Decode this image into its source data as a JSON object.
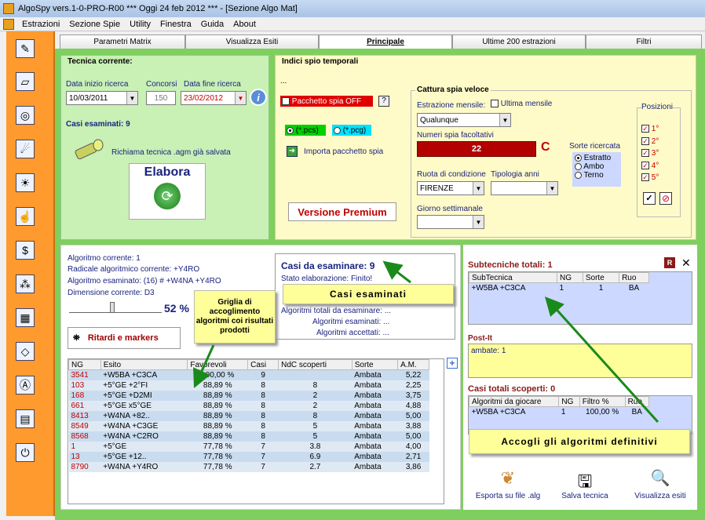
{
  "window": {
    "title": "AlgoSpy vers.1-0-PRO-R00  ***  Oggi 24 feb 2012  ***   - [Sezione Algo Mat]"
  },
  "menu": [
    "Estrazioni",
    "Sezione Spie",
    "Utility",
    "Finestra",
    "Guida",
    "About"
  ],
  "tabs": [
    "Parametri Matrix",
    "Visualizza Esiti",
    "Principale",
    "Ultime 200 estrazioni",
    "Filtri"
  ],
  "tecnica": {
    "legend": "Tecnica corrente:",
    "data_inizio_label": "Data inizio ricerca",
    "data_inizio": "10/03/2011",
    "concorsi_label": "Concorsi",
    "concorsi": "150",
    "data_fine_label": "Data fine ricerca",
    "data_fine": "23/02/2012",
    "casi_esaminati": "Casi esaminati: 9",
    "richiama": "Richiama tecnica .agm già salvata",
    "elabora": "Elabora"
  },
  "indici": {
    "legend": "Indici spio temporali",
    "ellipsis": "...",
    "pacchetto": "Pacchetto spia OFF",
    "help": "?",
    "pcs": "(*.pcs)",
    "pcg": "(*.pcg)",
    "importa": "Importa pacchetto spia",
    "premium": "Versione Premium",
    "cattura_legend": "Cattura spia veloce",
    "estrazione_mensile": "Estrazione mensile:",
    "ultima_mensile": "Ultima mensile",
    "qualunque": "Qualunque",
    "numeri_label": "Numeri spia facoltativi",
    "numeri_value": "22",
    "c_letter": "C",
    "ruota_label": "Ruota di condizione",
    "ruota": "FIRENZE",
    "tipologia_label": "Tipologia anni",
    "giorno_label": "Giorno settimanale",
    "sorte_label": "Sorte ricercata",
    "sorte_opts": [
      "Estratto",
      "Ambo",
      "Terno"
    ],
    "posizioni_label": "Posizioni",
    "posizioni": [
      "1°",
      "2°",
      "3°",
      "4°",
      "5°"
    ],
    "check_symbol": "✓",
    "stop_symbol": "⊘"
  },
  "algo": {
    "corrente": "Algoritmo corrente: 1",
    "radicale": "Radicale algoritmico corrente:   +Y4RO",
    "esaminato": "Algoritmo esaminato:   (16) # +W4NA +Y4RO",
    "dimensione": "Dimensione corrente:  D3",
    "percent": "52 %",
    "casi_title": "Casi da esaminare: 9",
    "stato": "Stato elaborazione: Finito!",
    "totali": "Algoritmi totali da esaminare:  ...",
    "esaminati": "Algoritmi esaminati:  ...",
    "accettati": "Algoritmi accettati:  ...",
    "ritardi": "Ritardi e markers"
  },
  "results": {
    "headers": [
      "NG",
      "Esito",
      "Favorevoli",
      "Casi",
      "NdC scoperti",
      "Sorte",
      "A.M."
    ],
    "rows": [
      [
        "3541",
        "+W5BA +C3CA",
        "100,00 %",
        "9",
        "",
        "Ambata",
        "5,22"
      ],
      [
        "103",
        "+5°GE +2°FI",
        "88,89 %",
        "8",
        "8",
        "Ambata",
        "2,25"
      ],
      [
        "168",
        "+5°GE +D2MI",
        "88,89 %",
        "8",
        "2",
        "Ambata",
        "3,75"
      ],
      [
        "661",
        "+5°GE x5°GE",
        "88,89 %",
        "8",
        "2",
        "Ambata",
        "4,88"
      ],
      [
        "8413",
        "+W4NA +82..",
        "88,89 %",
        "8",
        "8",
        "Ambata",
        "5,00"
      ],
      [
        "8549",
        "+W4NA +C3GE",
        "88,89 %",
        "8",
        "5",
        "Ambata",
        "3,88"
      ],
      [
        "8568",
        "+W4NA +C2RO",
        "88,89 %",
        "8",
        "5",
        "Ambata",
        "5,00"
      ],
      [
        "1",
        "+5°GE",
        "77,78 %",
        "7",
        "3.8",
        "Ambata",
        "4,00"
      ],
      [
        "13",
        "+5°GE +12..",
        "77,78 %",
        "7",
        "6.9",
        "Ambata",
        "2,71"
      ],
      [
        "8790",
        "+W4NA +Y4RO",
        "77,78 %",
        "7",
        "2.7",
        "Ambata",
        "3,86"
      ]
    ]
  },
  "subtecniche": {
    "title": "Subtecniche totali:  1",
    "headers": [
      "SubTecnica",
      "NG",
      "Sorte",
      "Ruo"
    ],
    "rows": [
      [
        "+W5BA +C3CA",
        "1",
        "1",
        "BA"
      ]
    ],
    "r_button": "R",
    "x_button": "✕"
  },
  "postit": {
    "title": "Post-It",
    "text": "ambate: 1"
  },
  "casi_scoperti": {
    "title": "Casi totali scoperti:  0",
    "headers": [
      "Algoritmi da giocare",
      "NG",
      "Filtro %",
      "Ruo"
    ],
    "rows": [
      [
        "+W5BA +C3CA",
        "1",
        "100,00 %",
        "BA"
      ]
    ]
  },
  "bottom_buttons": [
    "Esporta su file .alg",
    "Salva tecnica",
    "Visualizza esiti"
  ],
  "callouts": {
    "griglia": "Griglia di accoglimento algoritmi coi risultati prodotti",
    "casi": "Casi esaminati",
    "accogli": "Accogli gli algoritmi definitivi"
  },
  "colors": {
    "orange": "#ff9a2e",
    "green": "#7fcf5f",
    "red_field": "#b30000",
    "arrow": "#1a8a1a"
  }
}
